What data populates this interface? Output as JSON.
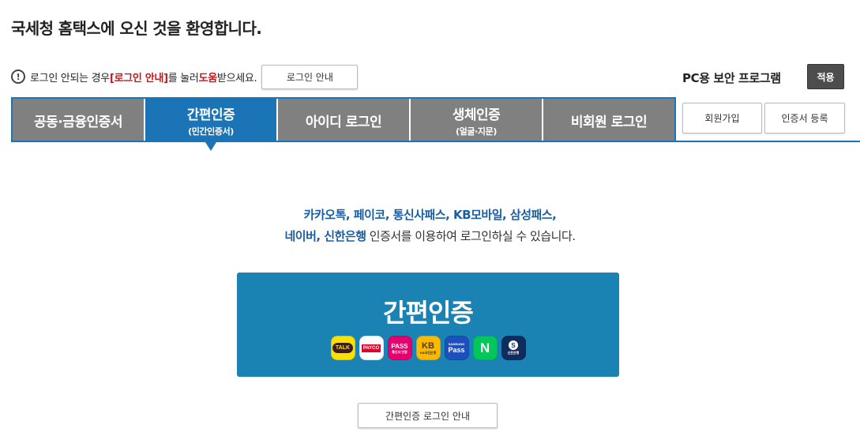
{
  "header": {
    "welcome": "국세청 홈택스에 오신 것을 환영합니다."
  },
  "help": {
    "icon": "info-icon",
    "text_before": "로그인 안되는 경우 ",
    "highlight_guide": "[로그인 안내]",
    "text_middle": "를 눌러 ",
    "highlight_help": "도움",
    "text_after": "받으세요.",
    "guide_button": "로그인 안내"
  },
  "security": {
    "label": "PC용 보안 프로그램",
    "apply_button": "적용"
  },
  "tabs": [
    {
      "label": "공동·금융인증서",
      "sub": ""
    },
    {
      "label": "간편인증",
      "sub": "(민간인증서)",
      "active": true
    },
    {
      "label": "아이디 로그인",
      "sub": ""
    },
    {
      "label": "생체인증",
      "sub": "(얼굴·지문)"
    },
    {
      "label": "비회원 로그인",
      "sub": ""
    }
  ],
  "side_buttons": {
    "join": "회원가입",
    "cert_register": "인증서 등록"
  },
  "content": {
    "providers_line1": "카카오톡, 페이코, 통신사패스, KB모바일, 삼성패스,",
    "providers_line2": "네이버, 신한은행",
    "desc_line2": " 인증서를 이용하여 로그인하실 수 있습니다.",
    "easy_title": "간편인증",
    "provider_icons": [
      {
        "name": "kakaotalk-icon",
        "label": "TALK"
      },
      {
        "name": "payco-icon",
        "label": "PAYCO"
      },
      {
        "name": "pass-icon",
        "label": "PASS",
        "sub": "통신사 인증"
      },
      {
        "name": "kb-icon",
        "label": "KB",
        "sub": "KB국민은행"
      },
      {
        "name": "samsung-pass-icon",
        "label": "Pass",
        "sub": "SAMSUNG"
      },
      {
        "name": "naver-icon",
        "label": "N"
      },
      {
        "name": "shinhan-icon",
        "label": "S",
        "sub": "신한은행"
      }
    ],
    "bottom_guide": "간편인증 로그인 안내"
  },
  "colors": {
    "tab_active": "#1a74b5",
    "tab_inactive": "#808080",
    "easy_box": "#1a83b4",
    "highlight_red": "#c4161c",
    "highlight_blue": "#1a5fa3"
  }
}
